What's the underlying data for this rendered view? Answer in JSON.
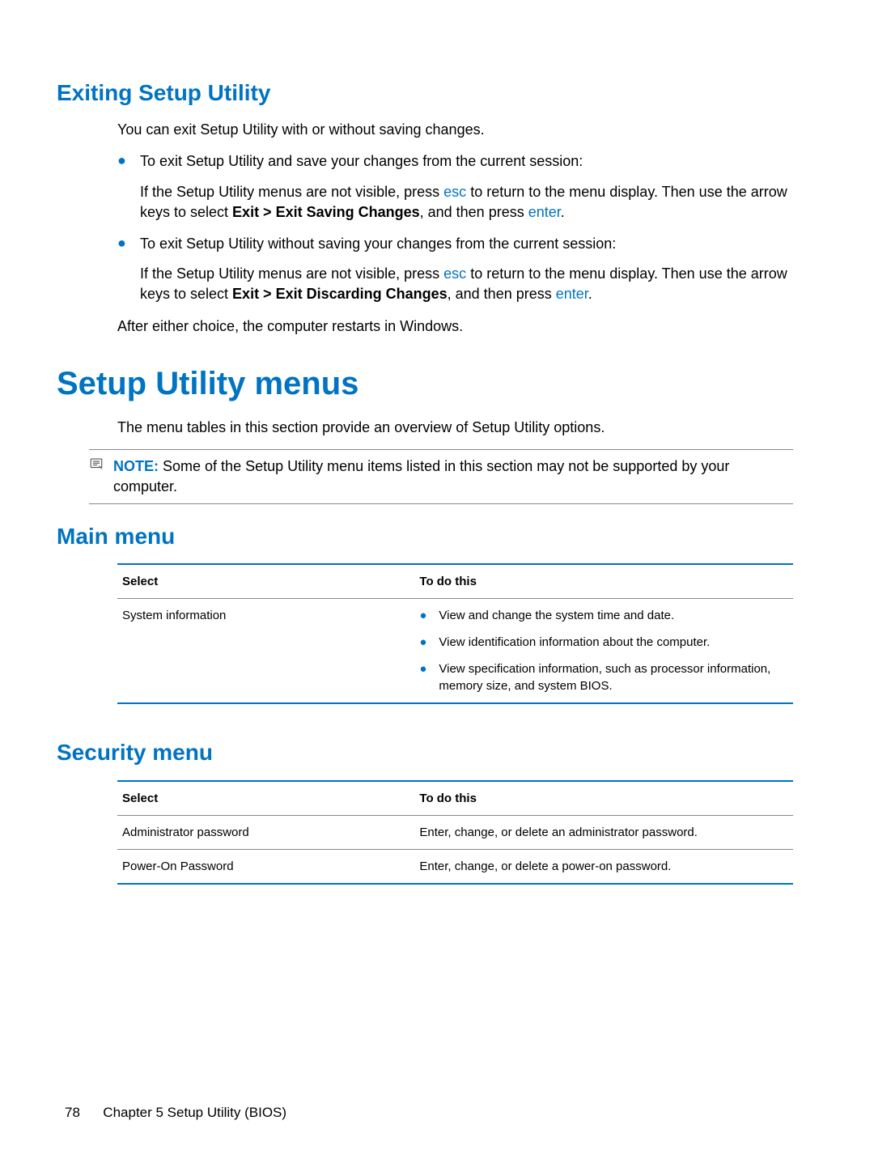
{
  "sections": {
    "exiting": {
      "heading": "Exiting Setup Utility",
      "intro": "You can exit Setup Utility with or without saving changes.",
      "bullet1": "To exit Setup Utility and save your changes from the current session:",
      "sub1_pre": "If the Setup Utility menus are not visible, press ",
      "sub1_key1": "esc",
      "sub1_mid": " to return to the menu display. Then use the arrow keys to select ",
      "sub1_bold": "Exit > Exit Saving Changes",
      "sub1_mid2": ", and then press ",
      "sub1_key2": "enter",
      "sub1_end": ".",
      "bullet2": "To exit Setup Utility without saving your changes from the current session:",
      "sub2_pre": "If the Setup Utility menus are not visible, press ",
      "sub2_key1": "esc",
      "sub2_mid": " to return to the menu display. Then use the arrow keys to select ",
      "sub2_bold": "Exit > Exit Discarding Changes",
      "sub2_mid2": ", and then press ",
      "sub2_key2": "enter",
      "sub2_end": ".",
      "after": "After either choice, the computer restarts in Windows."
    },
    "menus": {
      "heading": "Setup Utility menus",
      "intro": "The menu tables in this section provide an overview of Setup Utility options.",
      "note_label": "NOTE:",
      "note_text": "Some of the Setup Utility menu items listed in this section may not be supported by your computer."
    },
    "main_menu": {
      "heading": "Main menu",
      "col1": "Select",
      "col2": "To do this",
      "row1_select": "System information",
      "row1_item1": "View and change the system time and date.",
      "row1_item2": "View identification information about the computer.",
      "row1_item3": "View specification information, such as processor information, memory size, and system BIOS."
    },
    "security_menu": {
      "heading": "Security menu",
      "col1": "Select",
      "col2": "To do this",
      "row1_select": "Administrator password",
      "row1_action": "Enter, change, or delete an administrator password.",
      "row2_select": "Power-On Password",
      "row2_action": "Enter, change, or delete a power-on password."
    }
  },
  "footer": {
    "page": "78",
    "chapter": "Chapter 5   Setup Utility (BIOS)"
  }
}
